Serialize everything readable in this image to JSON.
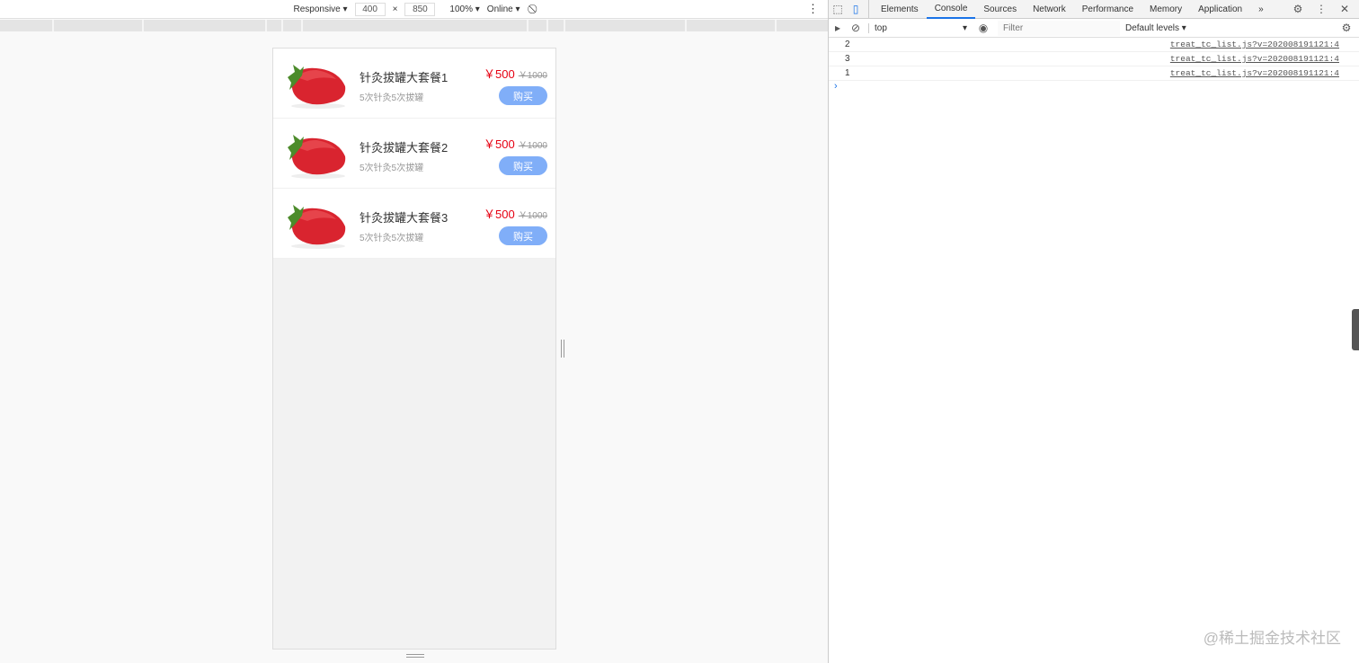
{
  "device_toolbar": {
    "mode": "Responsive",
    "width": "400",
    "height": "850",
    "times": "×",
    "zoom": "100%",
    "network": "Online"
  },
  "products": [
    {
      "name": "针灸拔罐大套餐1",
      "desc": "5次针灸5次拔罐",
      "price": "￥500",
      "original": "￥1000",
      "buy": "购买"
    },
    {
      "name": "针灸拔罐大套餐2",
      "desc": "5次针灸5次拔罐",
      "price": "￥500",
      "original": "￥1000",
      "buy": "购买"
    },
    {
      "name": "针灸拔罐大套餐3",
      "desc": "5次针灸5次拔罐",
      "price": "￥500",
      "original": "￥1000",
      "buy": "购买"
    }
  ],
  "devtools": {
    "tabs": [
      "Elements",
      "Console",
      "Sources",
      "Network",
      "Performance",
      "Memory",
      "Application"
    ],
    "active_tab": "Console",
    "more": "»",
    "context": "top",
    "filter_placeholder": "Filter",
    "levels": "Default levels ▾",
    "logs": [
      {
        "value": "2",
        "source": "treat_tc_list.js?v=202008191121:4"
      },
      {
        "value": "3",
        "source": "treat_tc_list.js?v=202008191121:4"
      },
      {
        "value": "1",
        "source": "treat_tc_list.js?v=202008191121:4"
      }
    ],
    "prompt": "›"
  },
  "watermark": "@稀土掘金技术社区"
}
